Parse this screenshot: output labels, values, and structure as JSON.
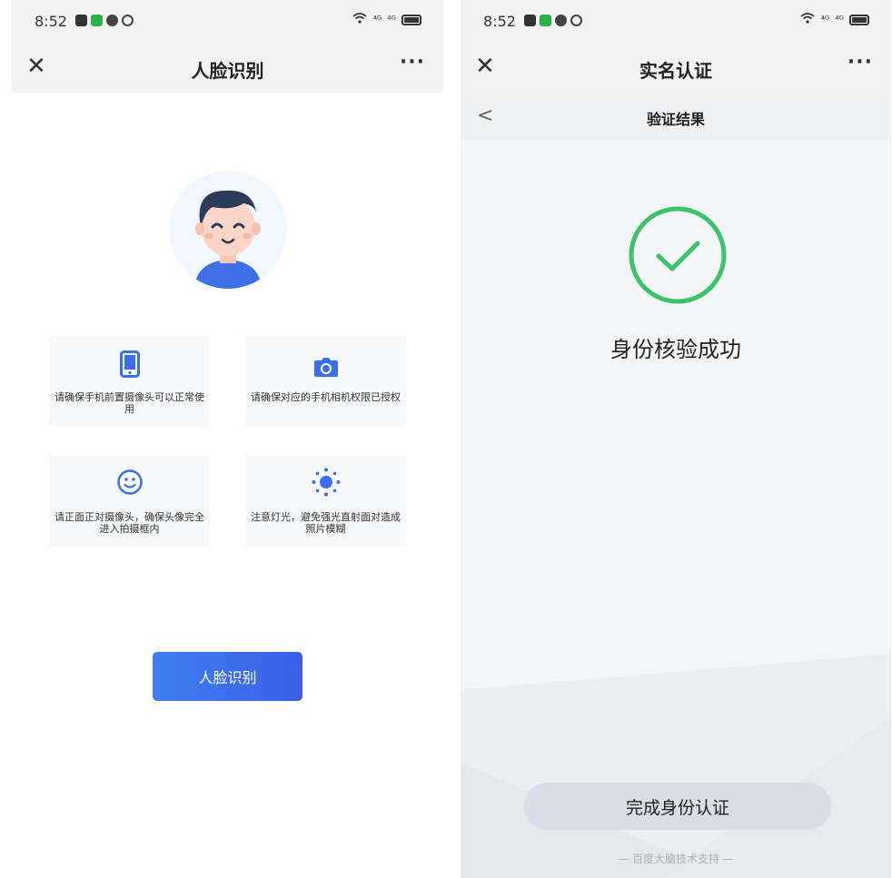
{
  "left": {
    "status": {
      "time": "8:52",
      "signal1": "⁴ᴳ",
      "signal2": "⁴ᴳ"
    },
    "nav": {
      "title": "人脸识别",
      "close": "✕",
      "more": "···"
    },
    "tips": [
      {
        "icon": "phone-icon",
        "text": "请确保手机前置摄像头可以正常使用"
      },
      {
        "icon": "camera-icon",
        "text": "请确保对应的手机相机权限已授权"
      },
      {
        "icon": "smiley-face-icon",
        "text": "请正面正对摄像头，确保头像完全进入拍摄框内"
      },
      {
        "icon": "sun-icon",
        "text": "注意灯光，避免强光直射面对造成照片模糊"
      }
    ],
    "button": "人脸识别"
  },
  "right": {
    "status": {
      "time": "8:52",
      "signal1": "⁴ᴳ",
      "signal2": "⁴ᴳ"
    },
    "nav": {
      "title": "实名认证",
      "close": "✕",
      "more": "···"
    },
    "subnav": {
      "back": "<",
      "title": "验证结果"
    },
    "result": "身份核验成功",
    "button": "完成身份认证",
    "footer": "— 百度大脑技术支持 —"
  },
  "colors": {
    "accent": "#3b6ff0",
    "success": "#3cc36a"
  }
}
